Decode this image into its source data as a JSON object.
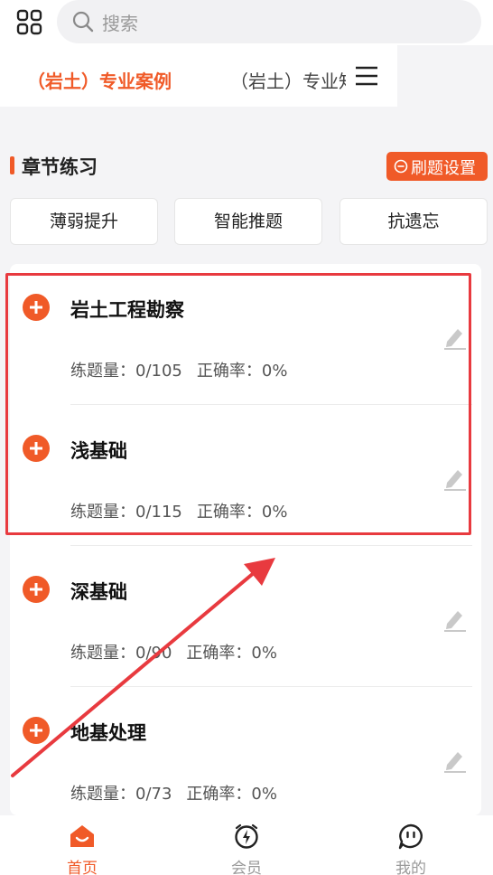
{
  "search": {
    "placeholder": "搜索"
  },
  "tabs": [
    {
      "label": "（岩土）专业案例",
      "active": true
    },
    {
      "label": "（岩土）专业知识",
      "active": false
    }
  ],
  "section": {
    "title": "章节练习",
    "settings_label": "刷题设置"
  },
  "modes": [
    "薄弱提升",
    "智能推题",
    "抗遗忘"
  ],
  "chapters": [
    {
      "title": "岩土工程勘察",
      "count_label": "练题量：0/105",
      "accuracy_label": "正确率：0%"
    },
    {
      "title": "浅基础",
      "count_label": "练题量：0/115",
      "accuracy_label": "正确率：0%"
    },
    {
      "title": "深基础",
      "count_label": "练题量：0/90",
      "accuracy_label": "正确率：0%"
    },
    {
      "title": "地基处理",
      "count_label": "练题量：0/73",
      "accuracy_label": "正确率：0%"
    }
  ],
  "bottom_nav": [
    {
      "label": "首页",
      "icon": "home-icon",
      "active": true
    },
    {
      "label": "会员",
      "icon": "vip-icon",
      "active": false
    },
    {
      "label": "我的",
      "icon": "profile-icon",
      "active": false
    }
  ],
  "colors": {
    "accent": "#f05a28",
    "highlight_box": "#e83a3f",
    "inactive_nav": "#9a9a9a"
  }
}
